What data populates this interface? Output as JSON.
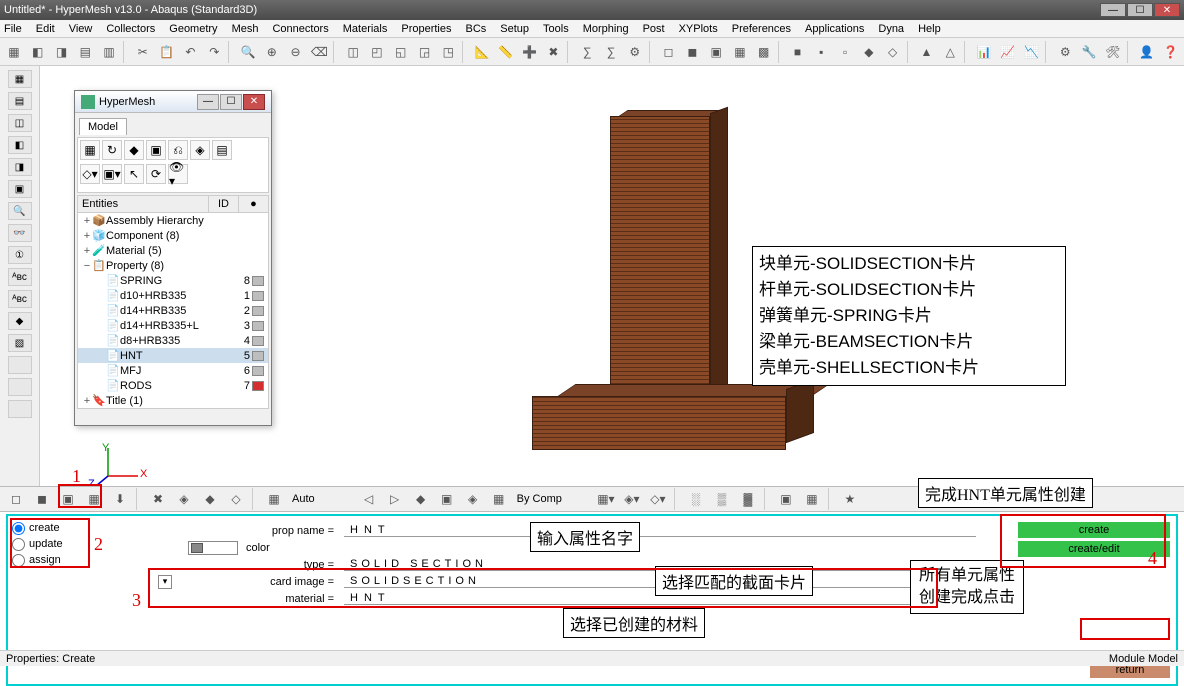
{
  "titlebar": {
    "text": "Untitled* - HyperMesh v13.0 - Abaqus (Standard3D)"
  },
  "menu": [
    "File",
    "Edit",
    "View",
    "Collectors",
    "Geometry",
    "Mesh",
    "Connectors",
    "Materials",
    "Properties",
    "BCs",
    "Setup",
    "Tools",
    "Morphing",
    "Post",
    "XYPlots",
    "Preferences",
    "Applications",
    "Dyna",
    "Help"
  ],
  "model_browser": {
    "title": "HyperMesh",
    "tab": "Model",
    "header": {
      "c1": "Entities",
      "c2": "ID"
    },
    "tree": [
      {
        "level": 0,
        "exp": "+",
        "icon": "📦",
        "label": "Assembly Hierarchy",
        "id": "",
        "swatch": ""
      },
      {
        "level": 0,
        "exp": "+",
        "icon": "🧊",
        "label": "Component (8)",
        "id": "",
        "swatch": ""
      },
      {
        "level": 0,
        "exp": "+",
        "icon": "🧪",
        "label": "Material (5)",
        "id": "",
        "swatch": ""
      },
      {
        "level": 0,
        "exp": "−",
        "icon": "📋",
        "label": "Property (8)",
        "id": "",
        "swatch": ""
      },
      {
        "level": 1,
        "exp": "",
        "icon": "📄",
        "label": "SPRING",
        "id": "8",
        "swatch": "#bdbdbd"
      },
      {
        "level": 1,
        "exp": "",
        "icon": "📄",
        "label": "d10+HRB335",
        "id": "1",
        "swatch": "#bdbdbd"
      },
      {
        "level": 1,
        "exp": "",
        "icon": "📄",
        "label": "d14+HRB335",
        "id": "2",
        "swatch": "#bdbdbd"
      },
      {
        "level": 1,
        "exp": "",
        "icon": "📄",
        "label": "d14+HRB335+L",
        "id": "3",
        "swatch": "#bdbdbd"
      },
      {
        "level": 1,
        "exp": "",
        "icon": "📄",
        "label": "d8+HRB335",
        "id": "4",
        "swatch": "#bdbdbd"
      },
      {
        "level": 1,
        "exp": "",
        "icon": "📄",
        "label": "HNT",
        "id": "5",
        "swatch": "#bdbdbd",
        "sel": true
      },
      {
        "level": 1,
        "exp": "",
        "icon": "📄",
        "label": "MFJ",
        "id": "6",
        "swatch": "#bdbdbd"
      },
      {
        "level": 1,
        "exp": "",
        "icon": "📄",
        "label": "RODS",
        "id": "7",
        "swatch": "#d32f2f"
      },
      {
        "level": 0,
        "exp": "+",
        "icon": "🔖",
        "label": "Title (1)",
        "id": "",
        "swatch": ""
      }
    ]
  },
  "axes": {
    "x": "X",
    "y": "Y",
    "z": "Z"
  },
  "lowbar": {
    "auto": "Auto",
    "bycomp": "By Comp"
  },
  "panel": {
    "radios": [
      "create",
      "update",
      "assign"
    ],
    "propname_label": "prop name =",
    "propname_value": "HNT",
    "color_label": "color",
    "type_label": "type =",
    "type_value": "SOLID SECTION",
    "cardimage_label": "card image =",
    "cardimage_value": "SOLIDSECTION",
    "material_label": "material =",
    "material_value": "HNT",
    "actions": {
      "create": "create",
      "createedit": "create/edit",
      "return": "return"
    }
  },
  "status": {
    "left": "Properties: Create",
    "right": "Module Model"
  },
  "annotations": {
    "cardmap": [
      "块单元-SOLIDSECTION卡片",
      "杆单元-SOLIDSECTION卡片",
      "弹簧单元-SPRING卡片",
      "梁单元-BEAMSECTION卡片",
      "壳单元-SHELLSECTION卡片"
    ],
    "a_name": "输入属性名字",
    "a_card": "选择匹配的截面卡片",
    "a_mat": "选择已创建的材料",
    "a_done1": "完成HNT单元属性创建",
    "a_done2a": "所有单元属性",
    "a_done2b": "创建完成点击",
    "n1": "1",
    "n2": "2",
    "n3": "3",
    "n4": "4"
  }
}
